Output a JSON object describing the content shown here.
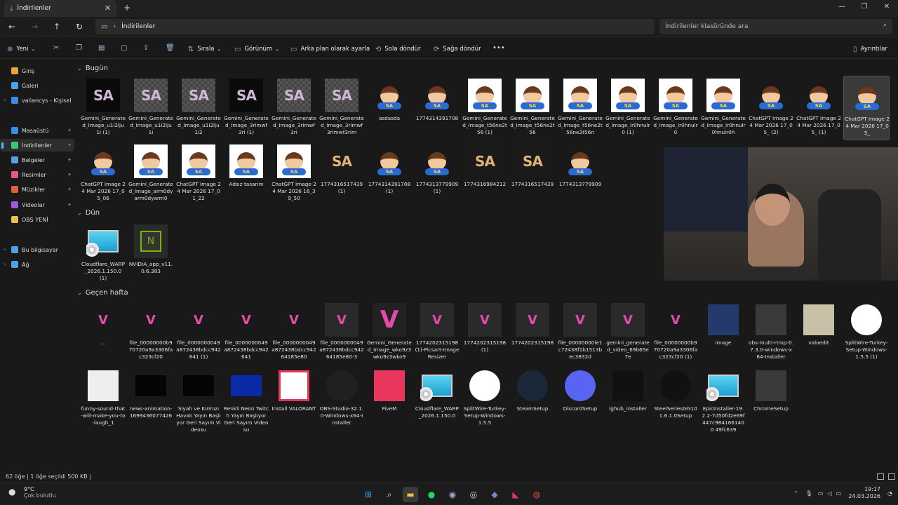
{
  "window": {
    "tab_title": "İndirilenler",
    "address_crumb": "İndirilenler",
    "search_placeholder": "İndirilenler klasöründe ara"
  },
  "toolbar": {
    "new_label": "Yeni",
    "sort_label": "Sırala",
    "view_label": "Görünüm",
    "set_background_label": "Arka plan olarak ayarla",
    "rotate_left_label": "Sola döndür",
    "rotate_right_label": "Sağa döndür",
    "details_label": "Ayrıntılar"
  },
  "sidebar": {
    "items": [
      {
        "label": "Giriş",
        "icon": "home-icon",
        "color": "#e8a33a"
      },
      {
        "label": "Galeri",
        "icon": "gallery-icon",
        "color": "#4aa3e8"
      },
      {
        "label": "valiancys - Kişisel",
        "icon": "cloud-icon",
        "color": "#3a8ee8"
      },
      {
        "label": "Masaüstü",
        "icon": "desktop-icon",
        "color": "#3a8ee8"
      },
      {
        "label": "İndirilenler",
        "icon": "download-icon",
        "color": "#3ac87a"
      },
      {
        "label": "Belgeler",
        "icon": "documents-icon",
        "color": "#5a9de0"
      },
      {
        "label": "Resimler",
        "icon": "pictures-icon",
        "color": "#e05a8a"
      },
      {
        "label": "Müzikler",
        "icon": "music-icon",
        "color": "#e0603a"
      },
      {
        "label": "Videolar",
        "icon": "videos-icon",
        "color": "#9a5ae0"
      },
      {
        "label": "OBS YENİ",
        "icon": "folder-icon",
        "color": "#e8c14a"
      },
      {
        "label": "Bu bilgisayar",
        "icon": "computer-icon",
        "color": "#4aa3e8"
      },
      {
        "label": "Ağ",
        "icon": "network-icon",
        "color": "#4aa3e8"
      }
    ]
  },
  "groups": {
    "today": "Bugün",
    "yesterday": "Dün",
    "last_week": "Geçen hafta"
  },
  "files_today": [
    {
      "name": "Gemini_Generated_Image_u1i2lju1i (1)",
      "kind": "sa-dark"
    },
    {
      "name": "Gemini_Generated_Image_u1i2lju1i",
      "kind": "sa-check"
    },
    {
      "name": "Gemini_Generated_Image_u1i2lju1i2",
      "kind": "sa-check"
    },
    {
      "name": "Gemini_Generated_Image_3rimwf3ri (1)",
      "kind": "sa-dark"
    },
    {
      "name": "Gemini_Generated_Image_3rimwf3ri",
      "kind": "sa-check"
    },
    {
      "name": "Gemini_Generated_Image_3rimwf3rimwf3rim",
      "kind": "sa-check"
    },
    {
      "name": "asdasda",
      "kind": "avatar-dark"
    },
    {
      "name": "1774314391708",
      "kind": "avatar-dark"
    },
    {
      "name": "Gemini_Generated_Image_t56ne2t56 (1)",
      "kind": "avatar"
    },
    {
      "name": "Gemini_Generated_Image_t56ne2t56",
      "kind": "avatar"
    },
    {
      "name": "Gemini_Generated_Image_t56ne2t56ne2t56n",
      "kind": "avatar"
    },
    {
      "name": "Gemini_Generated_Image_lr0hnulr0 (1)",
      "kind": "avatar"
    },
    {
      "name": "Gemini_Generated_Image_lr0hnulr0",
      "kind": "avatar"
    },
    {
      "name": "Gemini_Generated_Image_lr0hnulr0hnulr0h",
      "kind": "avatar"
    },
    {
      "name": "ChatGPT Image 24 Mar 2026 17_05_ (2)",
      "kind": "avatar-dark"
    },
    {
      "name": "ChatGPT Image 24 Mar 2026 17_05_ (1)",
      "kind": "avatar-dark"
    },
    {
      "name": "ChatGPT Image 24 Mar 2026 17_05_",
      "kind": "avatar-dark",
      "selected": true
    },
    {
      "name": "ChatGPT Image 24 Mar 2026 17_05_06",
      "kind": "avatar-dark"
    },
    {
      "name": "Gemini_Generated_Image_arm0dyarm0dyarm0",
      "kind": "avatar"
    },
    {
      "name": "ChatGPT Image 24 Mar 2026 17_01_22",
      "kind": "avatar"
    },
    {
      "name": "Adsız tasarım",
      "kind": "avatar"
    },
    {
      "name": "ChatGPT Image 24 Mar 2026 16_39_50",
      "kind": "avatar"
    },
    {
      "name": "1774316517439 (1)",
      "kind": "sa-orange"
    },
    {
      "name": "1774314391708 (1)",
      "kind": "avatar-dark"
    },
    {
      "name": "1774313779909 (1)",
      "kind": "avatar-dark"
    },
    {
      "name": "1774316984212",
      "kind": "sa-orange"
    },
    {
      "name": "1774316517439",
      "kind": "sa-orange"
    },
    {
      "name": "1774313779909",
      "kind": "avatar-dark"
    }
  ],
  "thumb_text": {
    "sa": "SA",
    "as": "AS",
    "v": "V",
    "nvidia": "N"
  },
  "files_yesterday": [
    {
      "name": "Cloudflare_WARP_2026.1.150.0 (1)",
      "kind": "monitor"
    },
    {
      "name": "NVIDIA_app_v11.0.6.383",
      "kind": "nvidia"
    }
  ],
  "files_lastweek": [
    {
      "name": "...",
      "kind": "v-small"
    },
    {
      "name": "file_00000000b970720a9a3306fac323cf20",
      "kind": "v-small"
    },
    {
      "name": "file_0000000049a872438bdcc942641 (1)",
      "kind": "v-small"
    },
    {
      "name": "file_0000000049a872438bdcc942641",
      "kind": "v-small"
    },
    {
      "name": "file_0000000049a872438bdcc94264185e80",
      "kind": "v-small"
    },
    {
      "name": "file_0000000049a872438bdcc94264185e80-3",
      "kind": "v-box"
    },
    {
      "name": "Gemini_Generated_Image_wko9z3wko9z3wko9",
      "kind": "v-big"
    },
    {
      "name": "1774202315198 (1)-Picsart-ImageResizer",
      "kind": "v-box"
    },
    {
      "name": "1774202315198 (1)",
      "kind": "v-box"
    },
    {
      "name": "1774202315198",
      "kind": "v-box"
    },
    {
      "name": "file_00000000le1c72438f1b1513bec3832d",
      "kind": "v-box"
    },
    {
      "name": "gemini_generated_video_69b65e7e",
      "kind": "v-box"
    },
    {
      "name": "file_00000000b970720a9a3306fac323cf20 (1)",
      "kind": "v-small"
    },
    {
      "name": "image",
      "kind": "photo"
    },
    {
      "name": "obs-multi-rtmp-0.7.3.0-windows-x64-Installer",
      "kind": "installer"
    },
    {
      "name": "valoedit",
      "kind": "photo-light"
    },
    {
      "name": "SplitWire-Turkey-Setup-Windows-1.5.5 (1)",
      "kind": "globe"
    },
    {
      "name": "funny-sound-that-will-make-you-to-laugh_1",
      "kind": "media"
    },
    {
      "name": "news-animation-1699436077426",
      "kind": "dark"
    },
    {
      "name": "Siyah ve Kırmızı Havalı Yayın Başlıyor Geri Sayım Videosu",
      "kind": "dark"
    },
    {
      "name": "Renkli Neon Twitch Yayın Başlıyor Geri Sayım Videosu",
      "kind": "blue"
    },
    {
      "name": "Install VALORANT",
      "kind": "valorant"
    },
    {
      "name": "OBS-Studio-32.1.0-Windows-x64-Installer",
      "kind": "obs"
    },
    {
      "name": "FiveM",
      "kind": "fivem"
    },
    {
      "name": "Cloudflare_WARP_2026.1.150.0",
      "kind": "monitor"
    },
    {
      "name": "SplitWire-Turkey-Setup-Windows-1.5.5",
      "kind": "globe"
    },
    {
      "name": "SteamSetup",
      "kind": "steam"
    },
    {
      "name": "DiscordSetup",
      "kind": "discord"
    },
    {
      "name": "lghub_installer",
      "kind": "lghub"
    },
    {
      "name": "SteelSeriesGG101.6.1.0Setup",
      "kind": "steelseries"
    },
    {
      "name": "EpicInstaller-19.2.2-7d50fd2e69f447c9841661400 49fc639",
      "kind": "monitor"
    },
    {
      "name": "ChromeSetup",
      "kind": "installer"
    }
  ],
  "status": {
    "summary": "62 öğe  |  1 öğe seçildi  500 KB  |"
  },
  "taskbar": {
    "temp": "9°C",
    "weather": "Çok bulutlu",
    "time": "19:17",
    "date": "24.03.2026"
  }
}
